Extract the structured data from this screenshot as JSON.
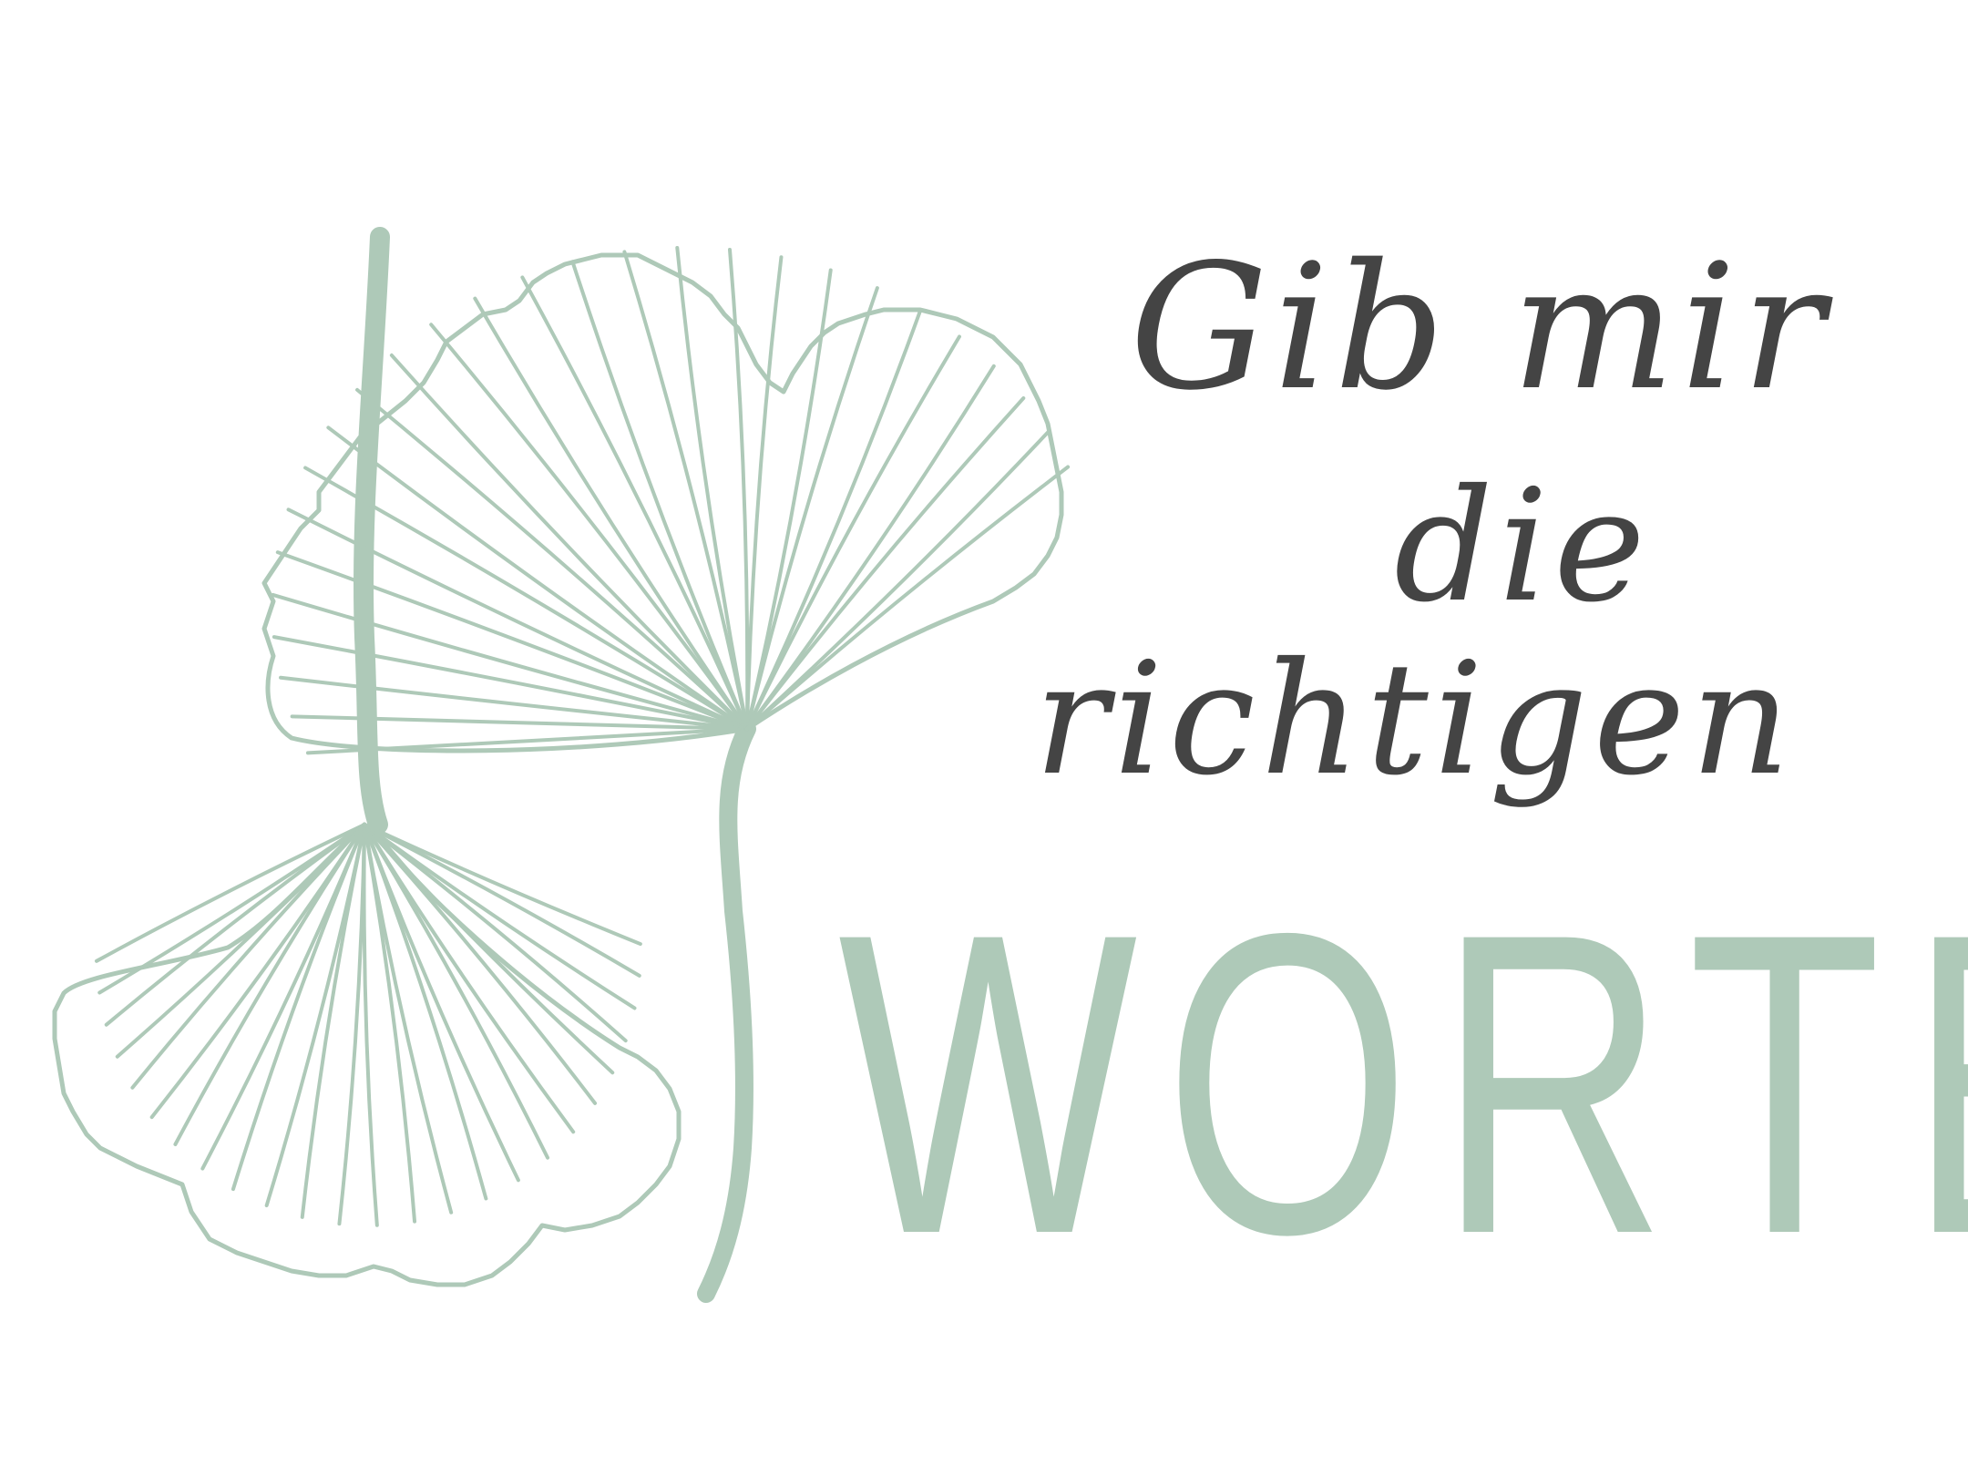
{
  "quote": {
    "line1": "Gib mir",
    "line2": "die",
    "line3": "richtigen",
    "word": "WORTE"
  },
  "colors": {
    "background": "#ffffff",
    "script_text": "#444444",
    "sage": "#aec9b8"
  },
  "decoration": {
    "icon": "ginkgo-leaves-icon"
  }
}
